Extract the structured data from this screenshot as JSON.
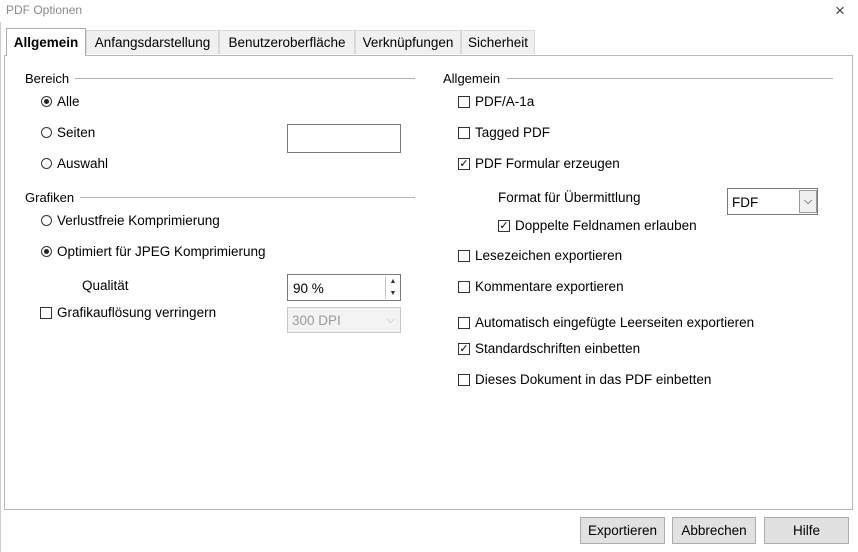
{
  "window": {
    "title": "PDF Optionen",
    "close_icon": "×"
  },
  "tabs": [
    {
      "label": "Allgemein"
    },
    {
      "label": "Anfangsdarstellung"
    },
    {
      "label": "Benutzeroberfläche"
    },
    {
      "label": "Verknüpfungen"
    },
    {
      "label": "Sicherheit"
    }
  ],
  "bereich": {
    "heading": "Bereich",
    "options": [
      {
        "label": "Alle",
        "selected": true
      },
      {
        "label": "Seiten",
        "selected": false
      },
      {
        "label": "Auswahl",
        "selected": false
      }
    ],
    "pages_value": ""
  },
  "grafiken": {
    "heading": "Grafiken",
    "lossless_label": "Verlustfreie Komprimierung",
    "jpeg_label": "Optimiert für JPEG Komprimierung",
    "quality_label": "Qualität",
    "quality_value": "90 %",
    "reduce_label": "Grafikauflösung verringern",
    "reduce_checked": false,
    "dpi_value": "300 DPI"
  },
  "allgemein": {
    "heading": "Allgemein",
    "pdfa_label": "PDF/A-1a",
    "tagged_label": "Tagged PDF",
    "form_label": "PDF Formular erzeugen",
    "format_label": "Format für Übermittlung",
    "format_value": "FDF",
    "dup_label": "Doppelte Feldnamen erlauben",
    "bookmarks_label": "Lesezeichen exportieren",
    "comments_label": "Kommentare exportieren",
    "blank_label": "Automatisch eingefügte Leerseiten exportieren",
    "fonts_label": "Standardschriften einbetten",
    "embed_label": "Dieses Dokument in das PDF einbetten",
    "check_mark": "✓"
  },
  "buttons": {
    "export": "Exportieren",
    "cancel": "Abbrechen",
    "help": "Hilfe"
  }
}
